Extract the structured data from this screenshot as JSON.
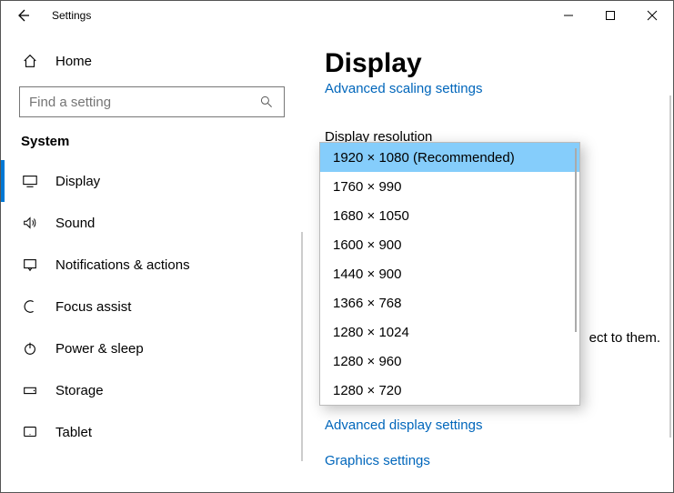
{
  "app_title": "Settings",
  "home_label": "Home",
  "search_placeholder": "Find a setting",
  "category": "System",
  "nav": [
    {
      "label": "Display",
      "icon": "display"
    },
    {
      "label": "Sound",
      "icon": "sound"
    },
    {
      "label": "Notifications & actions",
      "icon": "notifications"
    },
    {
      "label": "Focus assist",
      "icon": "focus"
    },
    {
      "label": "Power & sleep",
      "icon": "power"
    },
    {
      "label": "Storage",
      "icon": "storage"
    },
    {
      "label": "Tablet",
      "icon": "tablet"
    }
  ],
  "page_title": "Display",
  "peek_link": "Advanced scaling settings",
  "field_label": "Display resolution",
  "dropdown_options": [
    "1920 × 1080 (Recommended)",
    "1760 × 990",
    "1680 × 1050",
    "1600 × 900",
    "1440 × 900",
    "1366 × 768",
    "1280 × 1024",
    "1280 × 960",
    "1280 × 720"
  ],
  "dropdown_selected_index": 0,
  "advanced_display": "Advanced display settings",
  "graphics_settings": "Graphics settings",
  "peek_right": "ect to them."
}
